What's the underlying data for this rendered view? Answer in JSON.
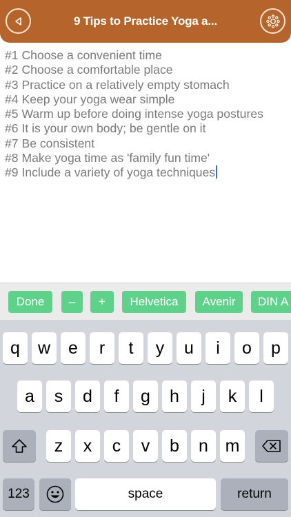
{
  "header": {
    "title": "9 Tips to Practice Yoga a...",
    "back_icon": "back-arrow-icon",
    "settings_icon": "gear-icon",
    "color": "#b5652b"
  },
  "tips": [
    "#1 Choose a convenient time",
    "#2 Choose a comfortable place",
    "#3 Practice on a relatively empty stomach",
    "#4 Keep your yoga wear simple",
    "#5 Warm up before doing intense yoga postures",
    "#6 It is your own body; be gentle on it",
    "#7 Be consistent",
    "#8 Make yoga time as 'family fun time'",
    "#9 Include a variety of yoga techniques"
  ],
  "toolbar": {
    "done": "Done",
    "minus": "–",
    "plus": "+",
    "fonts": [
      "Helvetica",
      "Avenir",
      "DIN A"
    ],
    "button_color": "#5ed28a"
  },
  "keyboard": {
    "row1": [
      "q",
      "w",
      "e",
      "r",
      "t",
      "y",
      "u",
      "i",
      "o",
      "p"
    ],
    "row2": [
      "a",
      "s",
      "d",
      "f",
      "g",
      "h",
      "j",
      "k",
      "l"
    ],
    "row3": [
      "z",
      "x",
      "c",
      "v",
      "b",
      "n",
      "m"
    ],
    "numbers": "123",
    "space": "space",
    "return": "return",
    "shift_icon": "shift-icon",
    "delete_icon": "delete-icon",
    "emoji_icon": "emoji-icon"
  }
}
